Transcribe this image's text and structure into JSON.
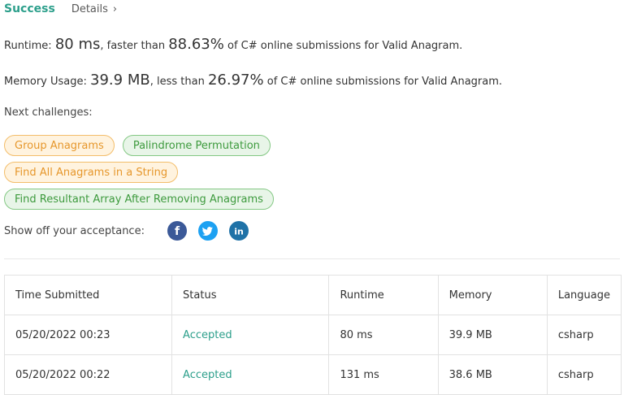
{
  "header": {
    "status": "Success",
    "details_label": "Details"
  },
  "runtime": {
    "label": "Runtime:",
    "value": "80 ms",
    "comparison": ", faster than",
    "percent": "88.63%",
    "suffix": "of C# online submissions for Valid Anagram."
  },
  "memory": {
    "label": "Memory Usage:",
    "value": "39.9 MB",
    "comparison": ", less than",
    "percent": "26.97%",
    "suffix": "of C# online submissions for Valid Anagram."
  },
  "next_challenges": {
    "label": "Next challenges:",
    "items": [
      {
        "label": "Group Anagrams",
        "difficulty_color": "orange"
      },
      {
        "label": "Palindrome Permutation",
        "difficulty_color": "green"
      },
      {
        "label": "Find All Anagrams in a String",
        "difficulty_color": "orange"
      },
      {
        "label": "Find Resultant Array After Removing Anagrams",
        "difficulty_color": "green"
      }
    ]
  },
  "share": {
    "label": "Show off your acceptance:",
    "icons": [
      "facebook-icon",
      "twitter-icon",
      "linkedin-icon"
    ]
  },
  "colors": {
    "accent": "#2c9f8b",
    "medium": "#e6972c",
    "easy": "#3d9a3d"
  },
  "submissions": {
    "headers": [
      "Time Submitted",
      "Status",
      "Runtime",
      "Memory",
      "Language"
    ],
    "rows": [
      [
        "05/20/2022 00:23",
        "Accepted",
        "80 ms",
        "39.9 MB",
        "csharp"
      ],
      [
        "05/20/2022 00:22",
        "Accepted",
        "131 ms",
        "38.6 MB",
        "csharp"
      ]
    ]
  }
}
